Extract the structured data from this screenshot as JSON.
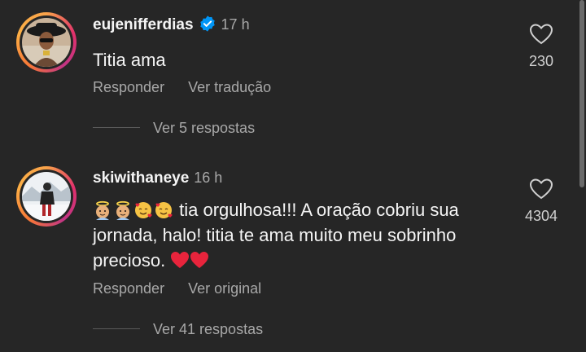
{
  "comments": [
    {
      "username": "eujenifferdias",
      "time": "17 h",
      "verified": true,
      "text": "Titia ama",
      "likes": "230",
      "actions": [
        "Responder",
        "Ver tradução"
      ],
      "replies_label": "Ver 5 respostas",
      "avatar_icon": "profile-photo-woman-hat",
      "like_icon": "heart-outline-icon"
    },
    {
      "username": "skiwithaneye",
      "time": "16 h",
      "verified": false,
      "emojis": [
        "baby-angel-emoji",
        "baby-angel-emoji",
        "smiling-face-with-hearts-emoji",
        "smiling-face-with-hearts-emoji"
      ],
      "text": "tia orgulhosa!!! A oração cobriu sua jornada, halo! titia te ama muito meu sobrinho precioso.",
      "trailing_emojis": [
        "red-heart-emoji",
        "red-heart-emoji"
      ],
      "likes": "4304",
      "actions": [
        "Responder",
        "Ver original"
      ],
      "replies_label": "Ver 41 respostas",
      "avatar_icon": "profile-photo-person-snow",
      "like_icon": "heart-outline-icon"
    }
  ],
  "colors": {
    "background": "#262626",
    "primary_text": "#f5f5f5",
    "secondary_text": "#a8a8a8",
    "verified_blue": "#0095f6"
  }
}
